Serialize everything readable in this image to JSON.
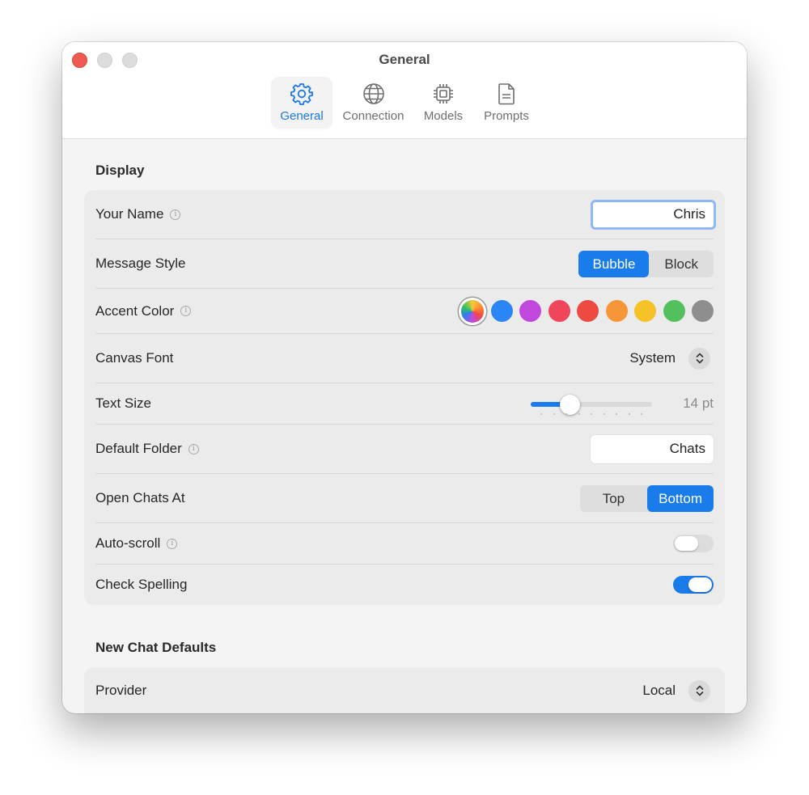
{
  "window": {
    "title": "General"
  },
  "tabs": [
    {
      "label": "General",
      "icon": "gear-icon",
      "active": true
    },
    {
      "label": "Connection",
      "icon": "globe-icon",
      "active": false
    },
    {
      "label": "Models",
      "icon": "chip-icon",
      "active": false
    },
    {
      "label": "Prompts",
      "icon": "document-icon",
      "active": false
    }
  ],
  "display": {
    "title": "Display",
    "your_name": {
      "label": "Your Name",
      "value": "Chris"
    },
    "message_style": {
      "label": "Message Style",
      "options": [
        "Bubble",
        "Block"
      ],
      "selected": "Bubble"
    },
    "accent_color": {
      "label": "Accent Color",
      "selected": "multicolor",
      "swatches": [
        "#2a86f4",
        "#c148dc",
        "#f0455a",
        "#ee4a44",
        "#f79638",
        "#f5c228",
        "#52c05c",
        "#8e8e8e"
      ]
    },
    "canvas_font": {
      "label": "Canvas Font",
      "value": "System"
    },
    "text_size": {
      "label": "Text Size",
      "value": "14 pt",
      "fraction": 0.29
    },
    "default_folder": {
      "label": "Default Folder",
      "value": "Chats"
    },
    "open_chats_at": {
      "label": "Open Chats At",
      "options": [
        "Top",
        "Bottom"
      ],
      "selected": "Bottom"
    },
    "auto_scroll": {
      "label": "Auto-scroll",
      "on": false
    },
    "check_spelling": {
      "label": "Check Spelling",
      "on": true
    }
  },
  "new_chat_defaults": {
    "title": "New Chat Defaults",
    "provider": {
      "label": "Provider",
      "value": "Local"
    }
  },
  "info_glyph": "i",
  "accent_blue": "#1a7bea"
}
